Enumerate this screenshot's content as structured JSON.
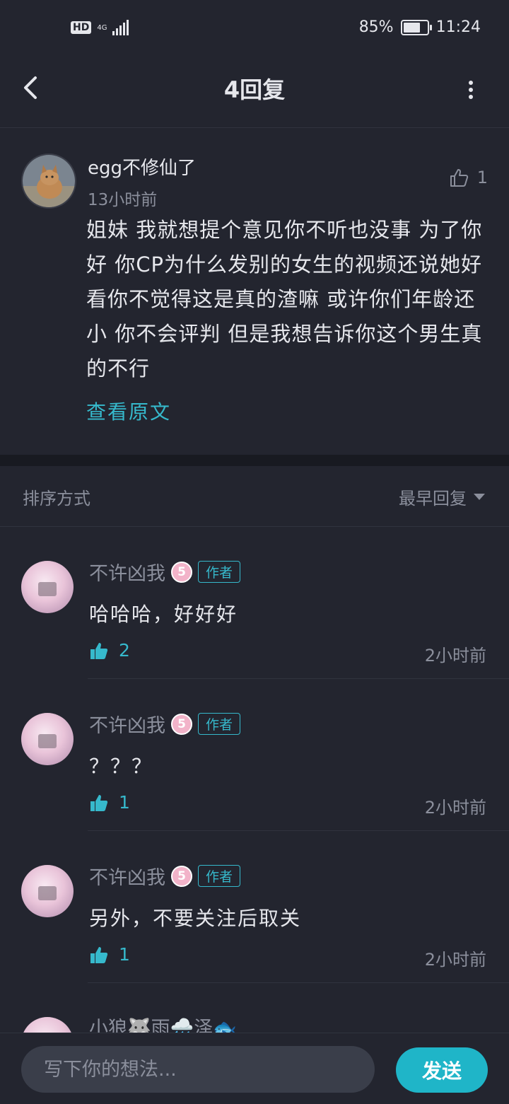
{
  "status_bar": {
    "hd_label": "HD",
    "network": "4G",
    "battery_text": "85%",
    "battery_level": 0.85,
    "time": "11:24"
  },
  "header": {
    "title": "4回复",
    "back_icon": "chevron-left-icon",
    "more_icon": "vertical-dots-icon"
  },
  "post": {
    "author": "egg不修仙了",
    "time": "13小时前",
    "like_count": "1",
    "text": "姐妹 我就想提个意见你不听也没事 为了你好 你CP为什么发别的女生的视频还说她好看你不觉得这是真的渣嘛 或许你们年龄还小 你不会评判 但是我想告诉你这个男生真的不行",
    "view_original": "查看原文"
  },
  "sort": {
    "label": "排序方式",
    "value": "最早回复"
  },
  "replies": [
    {
      "name": "不许凶我",
      "level": "5",
      "tag": "作者",
      "text": "哈哈哈，好好好",
      "likes": "2",
      "time": "2小时前"
    },
    {
      "name": "不许凶我",
      "level": "5",
      "tag": "作者",
      "text": "？？？",
      "likes": "1",
      "time": "2小时前"
    },
    {
      "name": "不许凶我",
      "level": "5",
      "tag": "作者",
      "text": "另外，不要关注后取关",
      "likes": "1",
      "time": "2小时前"
    }
  ],
  "partial_reply": {
    "name": "小狼🐺雨🌧️泽🐟"
  },
  "composer": {
    "placeholder": "写下你的想法...",
    "send_label": "发送"
  },
  "colors": {
    "background": "#23252f",
    "accent": "#36b9cc",
    "send_button": "#1fb5c8",
    "muted_text": "#8b8f9c"
  }
}
